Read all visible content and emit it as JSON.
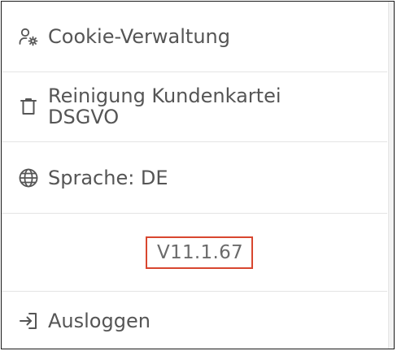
{
  "menu": {
    "items": [
      {
        "label": "Cookie-Verwaltung",
        "icon": "user-settings-icon"
      },
      {
        "label": "Reinigung Kundenkartei DSGVO",
        "icon": "trash-icon"
      },
      {
        "label": "Sprache: DE",
        "icon": "globe-icon"
      }
    ],
    "version": "V11.1.67",
    "logout": {
      "label": "Ausloggen",
      "icon": "logout-icon"
    }
  },
  "colors": {
    "text": "#555555",
    "version_text": "#6b6b6b",
    "highlight_border": "#d8462f",
    "divider": "#e4e4e4"
  }
}
